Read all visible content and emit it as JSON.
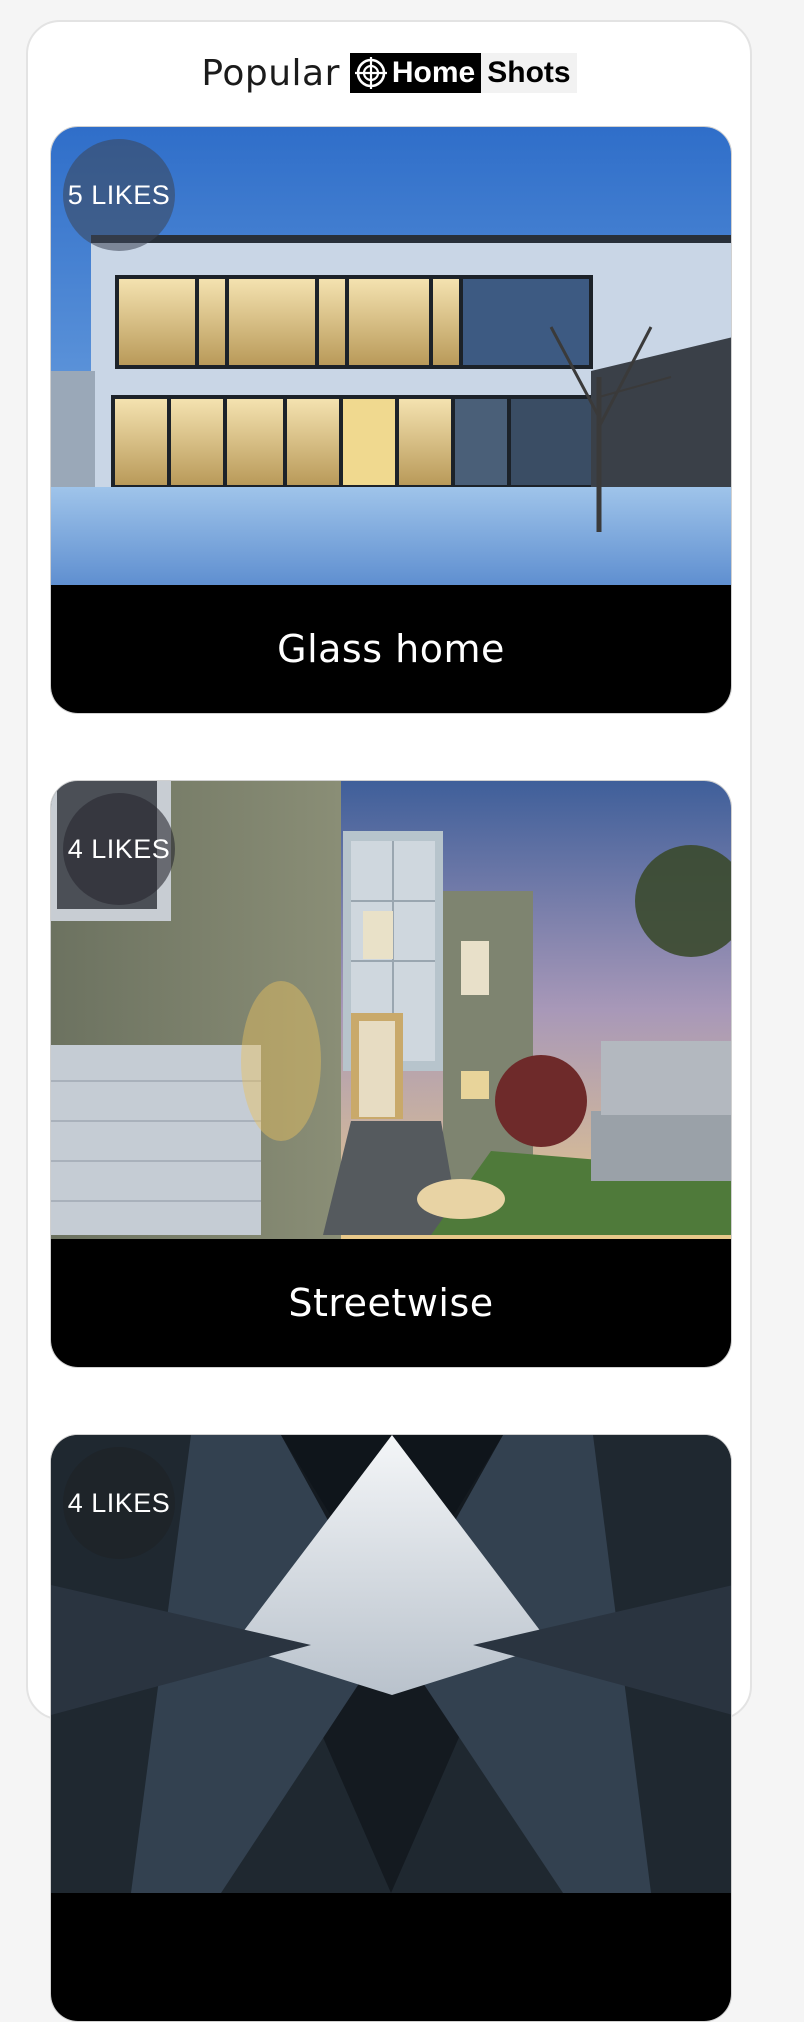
{
  "header": {
    "title": "Popular",
    "brand_home": "Home",
    "brand_shots": "Shots"
  },
  "cards": [
    {
      "likes": "5 LIKES",
      "title": "Glass home"
    },
    {
      "likes": "4 LIKES",
      "title": "Streetwise"
    },
    {
      "likes": "4 LIKES",
      "title": ""
    }
  ],
  "colors": {
    "page_bg": "#f5f5f5",
    "panel_bg": "#ffffff",
    "label_bg": "#000000",
    "label_text": "#ffffff"
  },
  "icons": {
    "brand_mark": "crosshair-icon"
  }
}
